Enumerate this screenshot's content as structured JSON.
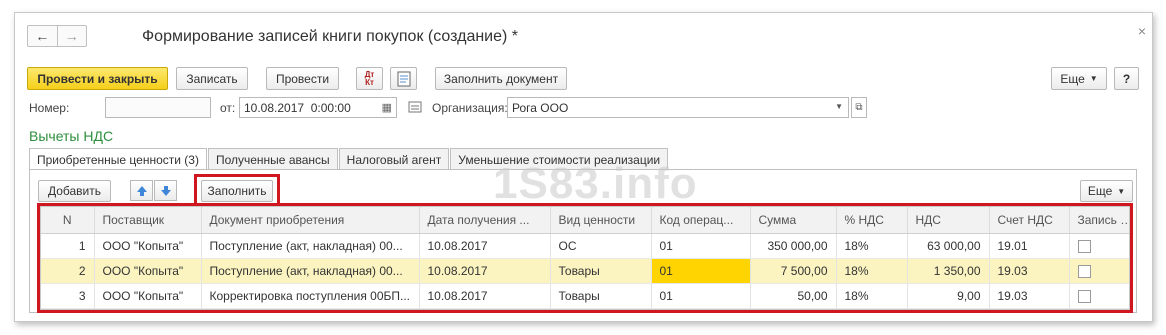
{
  "window": {
    "title": "Формирование записей книги покупок (создание) *",
    "close_glyph": "×",
    "nav_back": "←",
    "nav_forward": "→"
  },
  "toolbar": {
    "post_close_label": "Провести и закрыть",
    "save_label": "Записать",
    "post_label": "Провести",
    "dtkt_label": "Дт Кт",
    "fill_document_label": "Заполнить документ",
    "more_label": "Еще",
    "help_label": "?"
  },
  "form": {
    "number_label": "Номер:",
    "number_value": "",
    "from_label": "от:",
    "date_value": "10.08.2017  0:00:00",
    "org_label": "Организация:",
    "org_value": "Рога ООО"
  },
  "section": {
    "title": "Вычеты НДС"
  },
  "tabs": [
    {
      "label": "Приобретенные ценности (3)"
    },
    {
      "label": "Полученные авансы"
    },
    {
      "label": "Налоговый агент"
    },
    {
      "label": "Уменьшение стоимости реализации"
    }
  ],
  "table_toolbar": {
    "add_label": "Добавить",
    "fill_label": "Заполнить",
    "more_label": "Еще"
  },
  "watermark": "1S83.info",
  "table": {
    "columns": [
      "N",
      "Поставщик",
      "Документ приобретения",
      "Дата получения ...",
      "Вид ценности",
      "Код операц...",
      "Сумма",
      "% НДС",
      "НДС",
      "Счет НДС",
      "Запись до"
    ],
    "rows": [
      {
        "n": "1",
        "supplier": "ООО \"Копыта\"",
        "doc": "Поступление (акт, накладная) 00...",
        "date": "10.08.2017",
        "kind": "ОС",
        "code": "01",
        "sum": "350 000,00",
        "rate": "18%",
        "vat": "63 000,00",
        "account": "19.01"
      },
      {
        "n": "2",
        "supplier": "ООО \"Копыта\"",
        "doc": "Поступление (акт, накладная) 00...",
        "date": "10.08.2017",
        "kind": "Товары",
        "code": "01",
        "sum": "7 500,00",
        "rate": "18%",
        "vat": "1 350,00",
        "account": "19.03"
      },
      {
        "n": "3",
        "supplier": "ООО \"Копыта\"",
        "doc": "Корректировка поступления 00БП...",
        "date": "10.08.2017",
        "kind": "Товары",
        "code": "01",
        "sum": "50,00",
        "rate": "18%",
        "vat": "9,00",
        "account": "19.03"
      }
    ]
  },
  "colors": {
    "accent_green": "#2f8f3e",
    "primary_yellow": "#f5cf1a",
    "highlight_red": "#d0171f",
    "selected_row": "#fbf4c0"
  }
}
